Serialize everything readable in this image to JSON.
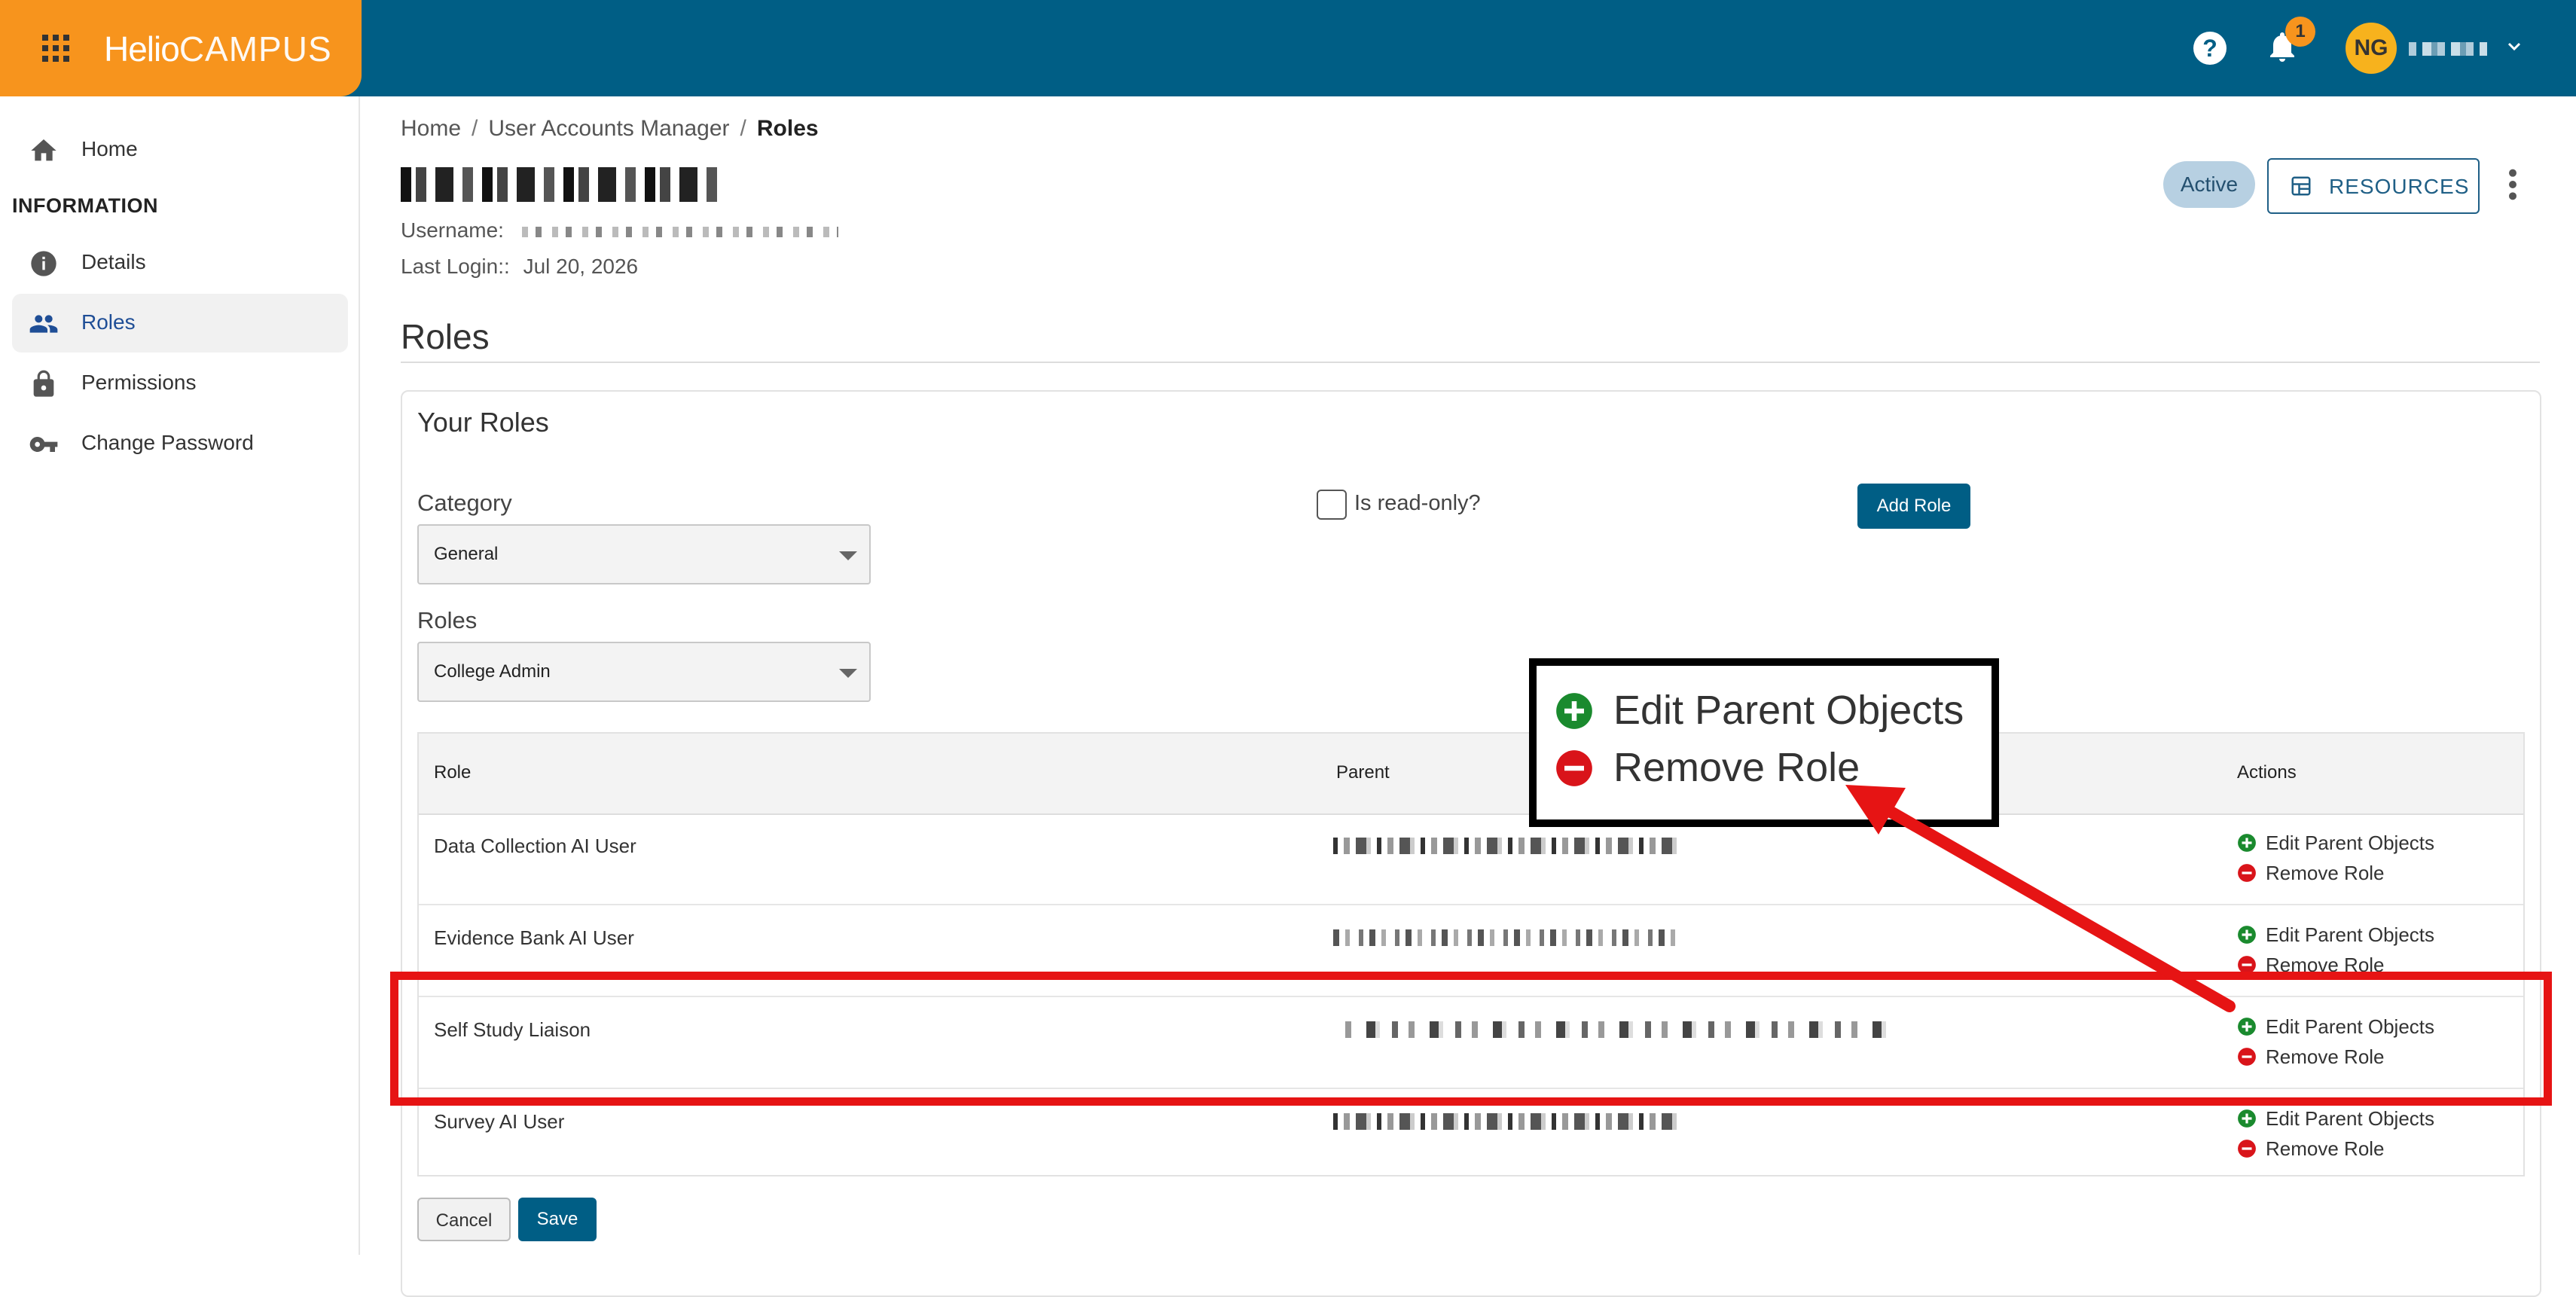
{
  "topbar": {
    "brand_part1": "Helio",
    "brand_part2": "CAMPUS",
    "notification_count": "1",
    "user_initials": "NG"
  },
  "sidebar": {
    "section_label": "INFORMATION",
    "items": [
      {
        "label": "Home",
        "icon": "home-icon"
      },
      {
        "label": "Details",
        "icon": "info-icon"
      },
      {
        "label": "Roles",
        "icon": "people-icon",
        "active": true
      },
      {
        "label": "Permissions",
        "icon": "lock-icon"
      },
      {
        "label": "Change Password",
        "icon": "key-icon"
      }
    ]
  },
  "breadcrumb": [
    "Home",
    "User Accounts Manager",
    "Roles"
  ],
  "user": {
    "username_label": "Username:",
    "last_login_label": "Last Login::",
    "last_login_value": "Jul 20, 2026",
    "status": "Active"
  },
  "header": {
    "resources_label": "RESOURCES"
  },
  "page": {
    "title": "Roles"
  },
  "card": {
    "title": "Your Roles",
    "category_label": "Category",
    "category_value": "General",
    "roles_label": "Roles",
    "roles_value": "College Admin",
    "readonly_label": "Is read-only?",
    "add_role_label": "Add Role"
  },
  "table": {
    "headers": [
      "Role",
      "Parent",
      "Actions"
    ],
    "rows": [
      {
        "role": "Data Collection AI User"
      },
      {
        "role": "Evidence Bank AI User"
      },
      {
        "role": "Self Study Liaison"
      },
      {
        "role": "Survey AI User"
      }
    ],
    "action_edit": "Edit Parent Objects",
    "action_remove": "Remove Role"
  },
  "footer": {
    "cancel_label": "Cancel",
    "save_label": "Save"
  },
  "callout": {
    "edit_label": "Edit Parent Objects",
    "remove_label": "Remove Role"
  },
  "colors": {
    "topbar": "#005e85",
    "brand": "#f7941d",
    "highlight": "#e61414",
    "add_green": "#1a8a2e",
    "remove_red": "#d9141a"
  }
}
